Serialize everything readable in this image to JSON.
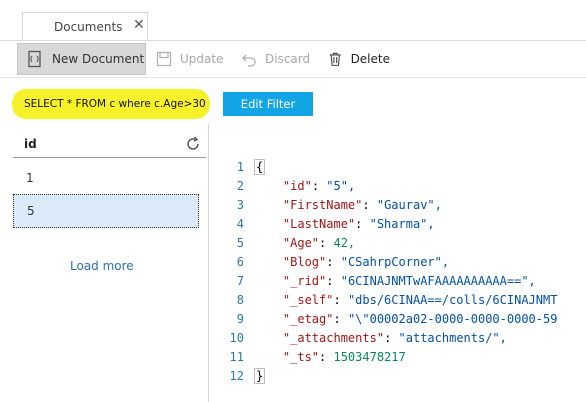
{
  "tab": {
    "label": "Documents",
    "close_glyph": "✕"
  },
  "toolbar": {
    "new_document": "New Document",
    "update": "Update",
    "discard": "Discard",
    "delete": "Delete"
  },
  "query": {
    "text": "SELECT * FROM c where c.Age>30",
    "highlight_color": "#f7f12a"
  },
  "edit_filter": {
    "label": "Edit Filter",
    "color": "#12a4e4"
  },
  "list": {
    "column": "id",
    "rows": [
      "1",
      "5"
    ],
    "selected": "5",
    "load_more": "Load more"
  },
  "editor": {
    "line_numbers": [
      "1",
      "2",
      "3",
      "4",
      "5",
      "6",
      "7",
      "8",
      "9",
      "10",
      "11",
      "12"
    ],
    "open_brace": "{",
    "close_brace": "}",
    "fields": [
      {
        "key": "\"id\"",
        "value": "\"5\",",
        "type": "string"
      },
      {
        "key": "\"FirstName\"",
        "value": "\"Gaurav\",",
        "type": "string"
      },
      {
        "key": "\"LastName\"",
        "value": "\"Sharma\",",
        "type": "string"
      },
      {
        "key": "\"Age\"",
        "value": "42,",
        "type": "number"
      },
      {
        "key": "\"Blog\"",
        "value": "\"CSahrpCorner\",",
        "type": "string"
      },
      {
        "key": "\"_rid\"",
        "value": "\"6CINAJNMTwAFAAAAAAAAAA==\",",
        "type": "string"
      },
      {
        "key": "\"_self\"",
        "value": "\"dbs/6CINAA==/colls/6CINAJNMT",
        "type": "string"
      },
      {
        "key": "\"_etag\"",
        "value": "\"\\\"00002a02-0000-0000-0000-59",
        "type": "string"
      },
      {
        "key": "\"_attachments\"",
        "value": "\"attachments/\",",
        "type": "string"
      },
      {
        "key": "\"_ts\"",
        "value": "1503478217",
        "type": "number"
      }
    ]
  },
  "icons": {
    "new_document": "new-document-icon",
    "update": "save-icon",
    "discard": "undo-icon",
    "delete": "trash-icon",
    "refresh": "refresh-icon"
  }
}
